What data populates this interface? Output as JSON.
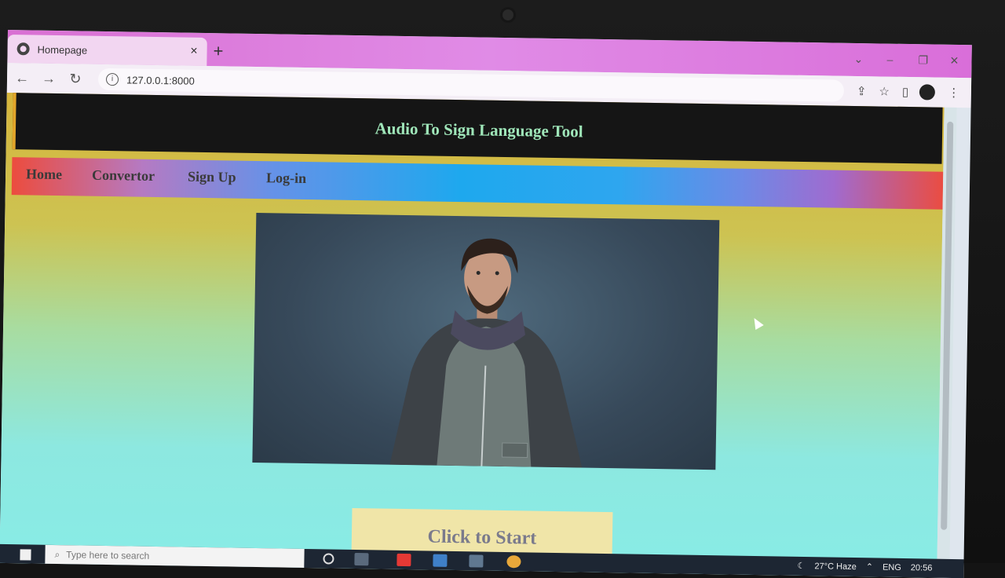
{
  "browser": {
    "tab_title": "Homepage",
    "tab_close": "×",
    "new_tab": "+",
    "url": "127.0.0.1:8000",
    "back": "←",
    "forward": "→",
    "reload": "↻"
  },
  "page": {
    "site_title": "Audio To Sign Language Tool",
    "nav": [
      "Home",
      "Convertor",
      "Sign Up",
      "Log-in"
    ],
    "start_button": "Click to Start"
  },
  "taskbar": {
    "search_placeholder": "Type here to search",
    "weather": "27°C Haze",
    "language": "ENG",
    "time": "20:56"
  },
  "colors": {
    "header_bg": "#151515",
    "title_color": "#9fe6b9",
    "button_bg": "#f0e5a8"
  }
}
